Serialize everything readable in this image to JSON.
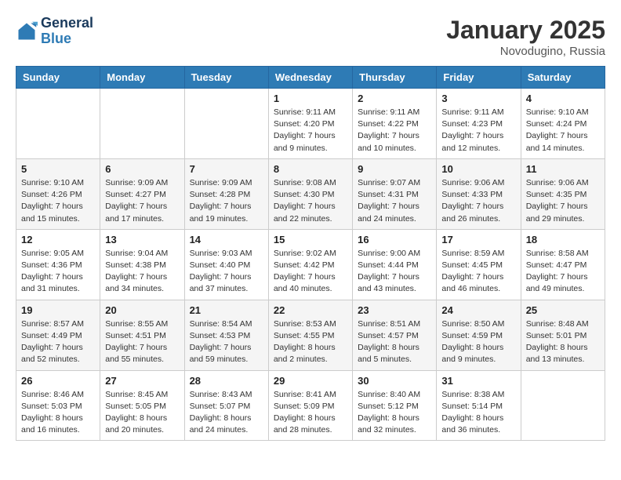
{
  "logo": {
    "line1": "General",
    "line2": "Blue"
  },
  "title": "January 2025",
  "location": "Novodugino, Russia",
  "days_of_week": [
    "Sunday",
    "Monday",
    "Tuesday",
    "Wednesday",
    "Thursday",
    "Friday",
    "Saturday"
  ],
  "weeks": [
    [
      {
        "day": "",
        "detail": ""
      },
      {
        "day": "",
        "detail": ""
      },
      {
        "day": "",
        "detail": ""
      },
      {
        "day": "1",
        "detail": "Sunrise: 9:11 AM\nSunset: 4:20 PM\nDaylight: 7 hours\nand 9 minutes."
      },
      {
        "day": "2",
        "detail": "Sunrise: 9:11 AM\nSunset: 4:22 PM\nDaylight: 7 hours\nand 10 minutes."
      },
      {
        "day": "3",
        "detail": "Sunrise: 9:11 AM\nSunset: 4:23 PM\nDaylight: 7 hours\nand 12 minutes."
      },
      {
        "day": "4",
        "detail": "Sunrise: 9:10 AM\nSunset: 4:24 PM\nDaylight: 7 hours\nand 14 minutes."
      }
    ],
    [
      {
        "day": "5",
        "detail": "Sunrise: 9:10 AM\nSunset: 4:26 PM\nDaylight: 7 hours\nand 15 minutes."
      },
      {
        "day": "6",
        "detail": "Sunrise: 9:09 AM\nSunset: 4:27 PM\nDaylight: 7 hours\nand 17 minutes."
      },
      {
        "day": "7",
        "detail": "Sunrise: 9:09 AM\nSunset: 4:28 PM\nDaylight: 7 hours\nand 19 minutes."
      },
      {
        "day": "8",
        "detail": "Sunrise: 9:08 AM\nSunset: 4:30 PM\nDaylight: 7 hours\nand 22 minutes."
      },
      {
        "day": "9",
        "detail": "Sunrise: 9:07 AM\nSunset: 4:31 PM\nDaylight: 7 hours\nand 24 minutes."
      },
      {
        "day": "10",
        "detail": "Sunrise: 9:06 AM\nSunset: 4:33 PM\nDaylight: 7 hours\nand 26 minutes."
      },
      {
        "day": "11",
        "detail": "Sunrise: 9:06 AM\nSunset: 4:35 PM\nDaylight: 7 hours\nand 29 minutes."
      }
    ],
    [
      {
        "day": "12",
        "detail": "Sunrise: 9:05 AM\nSunset: 4:36 PM\nDaylight: 7 hours\nand 31 minutes."
      },
      {
        "day": "13",
        "detail": "Sunrise: 9:04 AM\nSunset: 4:38 PM\nDaylight: 7 hours\nand 34 minutes."
      },
      {
        "day": "14",
        "detail": "Sunrise: 9:03 AM\nSunset: 4:40 PM\nDaylight: 7 hours\nand 37 minutes."
      },
      {
        "day": "15",
        "detail": "Sunrise: 9:02 AM\nSunset: 4:42 PM\nDaylight: 7 hours\nand 40 minutes."
      },
      {
        "day": "16",
        "detail": "Sunrise: 9:00 AM\nSunset: 4:44 PM\nDaylight: 7 hours\nand 43 minutes."
      },
      {
        "day": "17",
        "detail": "Sunrise: 8:59 AM\nSunset: 4:45 PM\nDaylight: 7 hours\nand 46 minutes."
      },
      {
        "day": "18",
        "detail": "Sunrise: 8:58 AM\nSunset: 4:47 PM\nDaylight: 7 hours\nand 49 minutes."
      }
    ],
    [
      {
        "day": "19",
        "detail": "Sunrise: 8:57 AM\nSunset: 4:49 PM\nDaylight: 7 hours\nand 52 minutes."
      },
      {
        "day": "20",
        "detail": "Sunrise: 8:55 AM\nSunset: 4:51 PM\nDaylight: 7 hours\nand 55 minutes."
      },
      {
        "day": "21",
        "detail": "Sunrise: 8:54 AM\nSunset: 4:53 PM\nDaylight: 7 hours\nand 59 minutes."
      },
      {
        "day": "22",
        "detail": "Sunrise: 8:53 AM\nSunset: 4:55 PM\nDaylight: 8 hours\nand 2 minutes."
      },
      {
        "day": "23",
        "detail": "Sunrise: 8:51 AM\nSunset: 4:57 PM\nDaylight: 8 hours\nand 5 minutes."
      },
      {
        "day": "24",
        "detail": "Sunrise: 8:50 AM\nSunset: 4:59 PM\nDaylight: 8 hours\nand 9 minutes."
      },
      {
        "day": "25",
        "detail": "Sunrise: 8:48 AM\nSunset: 5:01 PM\nDaylight: 8 hours\nand 13 minutes."
      }
    ],
    [
      {
        "day": "26",
        "detail": "Sunrise: 8:46 AM\nSunset: 5:03 PM\nDaylight: 8 hours\nand 16 minutes."
      },
      {
        "day": "27",
        "detail": "Sunrise: 8:45 AM\nSunset: 5:05 PM\nDaylight: 8 hours\nand 20 minutes."
      },
      {
        "day": "28",
        "detail": "Sunrise: 8:43 AM\nSunset: 5:07 PM\nDaylight: 8 hours\nand 24 minutes."
      },
      {
        "day": "29",
        "detail": "Sunrise: 8:41 AM\nSunset: 5:09 PM\nDaylight: 8 hours\nand 28 minutes."
      },
      {
        "day": "30",
        "detail": "Sunrise: 8:40 AM\nSunset: 5:12 PM\nDaylight: 8 hours\nand 32 minutes."
      },
      {
        "day": "31",
        "detail": "Sunrise: 8:38 AM\nSunset: 5:14 PM\nDaylight: 8 hours\nand 36 minutes."
      },
      {
        "day": "",
        "detail": ""
      }
    ]
  ]
}
